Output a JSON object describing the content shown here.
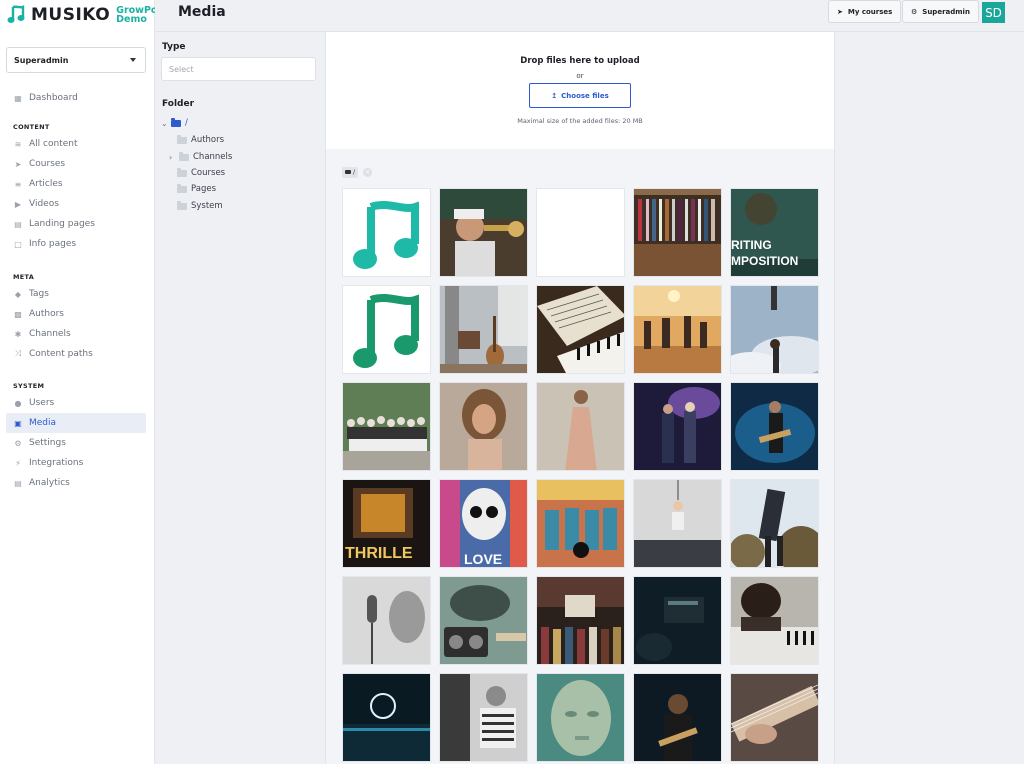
{
  "brand": {
    "name": "MUSIKO",
    "sub_line1": "GrowPoint",
    "sub_line2": "Demo",
    "accent": "#19b3a3"
  },
  "role_select": {
    "value": "Superadmin"
  },
  "nav": {
    "dashboard": "Dashboard",
    "content_title": "CONTENT",
    "content": [
      "All content",
      "Courses",
      "Articles",
      "Videos",
      "Landing pages",
      "Info pages"
    ],
    "meta_title": "META",
    "meta": [
      "Tags",
      "Authors",
      "Channels",
      "Content paths"
    ],
    "system_title": "SYSTEM",
    "system": [
      "Users",
      "Media",
      "Settings",
      "Integrations",
      "Analytics"
    ],
    "active": "Media"
  },
  "header": {
    "title": "Media",
    "my_courses": "My courses",
    "superadmin": "Superadmin",
    "avatar_initials": "SD"
  },
  "filter": {
    "type_label": "Type",
    "type_placeholder": "Select",
    "folder_label": "Folder",
    "root": "/",
    "folders": [
      "Authors",
      "Channels",
      "Courses",
      "Pages",
      "System"
    ]
  },
  "upload": {
    "drop_text": "Drop files here to upload",
    "or_text": "or",
    "choose_label": "Choose files",
    "max_size": "Maximal size of the added files: 20 MB"
  },
  "breadcrumb": {
    "path": "/"
  },
  "media_items": [
    {
      "name": "logo-teal"
    },
    {
      "name": "trumpet-player"
    },
    {
      "name": "blank-white"
    },
    {
      "name": "record-shelf"
    },
    {
      "name": "writing-composition",
      "overlay_line1": "RITING",
      "overlay_line2": "MPOSITION"
    },
    {
      "name": "logo-green"
    },
    {
      "name": "guitar-room"
    },
    {
      "name": "sheet-music-piano"
    },
    {
      "name": "people-sunset"
    },
    {
      "name": "hands-sky"
    },
    {
      "name": "group-photo"
    },
    {
      "name": "woman-curly-hair"
    },
    {
      "name": "woman-dress"
    },
    {
      "name": "concert-duo"
    },
    {
      "name": "guitarist-stage"
    },
    {
      "name": "thriller-sign",
      "overlay_text": "THRILLE"
    },
    {
      "name": "lennon-mural",
      "overlay_text": "LOVE"
    },
    {
      "name": "beatles-mural"
    },
    {
      "name": "hanging-figure"
    },
    {
      "name": "jumping-man"
    },
    {
      "name": "singer-microphone"
    },
    {
      "name": "radio-relax"
    },
    {
      "name": "vinyl-crates"
    },
    {
      "name": "dark-synth"
    },
    {
      "name": "woman-piano"
    },
    {
      "name": "neon-studio"
    },
    {
      "name": "accordion-player"
    },
    {
      "name": "statue-head"
    },
    {
      "name": "bass-player"
    },
    {
      "name": "guitar-closeup"
    }
  ]
}
